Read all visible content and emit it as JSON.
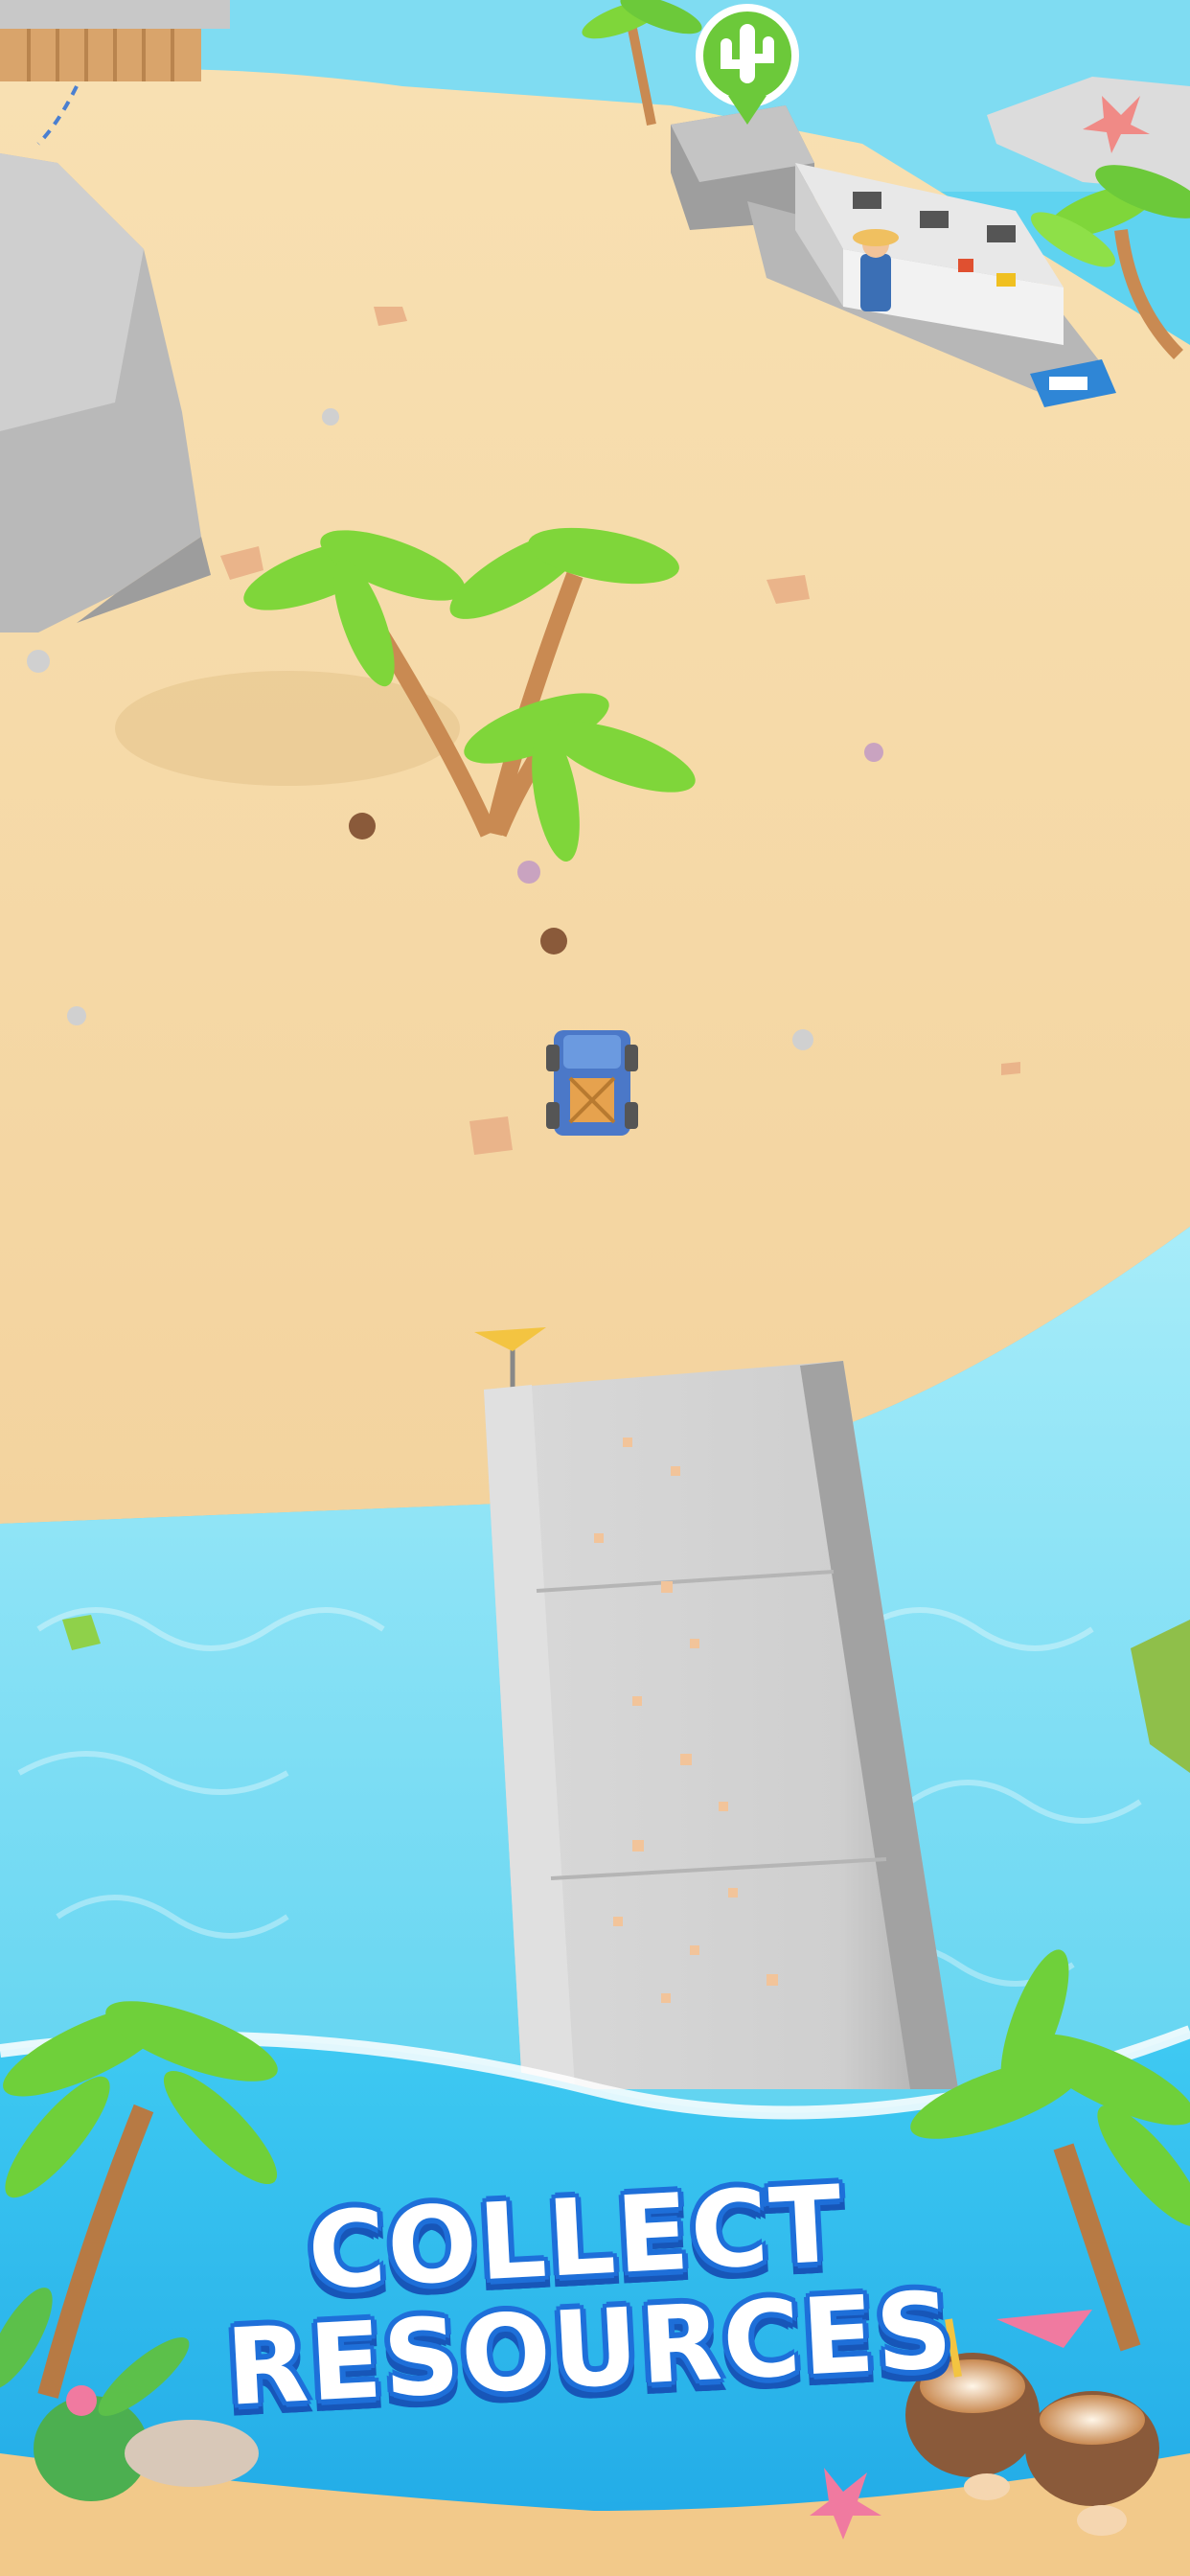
{
  "caption": {
    "line1": "COLLECT",
    "line2": "RESOURCES"
  },
  "colors": {
    "sand": "#f5d9a8",
    "water": "#7fdcf2",
    "deep_water": "#2cc0ee",
    "bridge": "#c9c9c9",
    "palm_leaf": "#7fd63a",
    "text_outline": "#1e6fd9"
  },
  "icons": {
    "marker": "cactus-icon"
  }
}
